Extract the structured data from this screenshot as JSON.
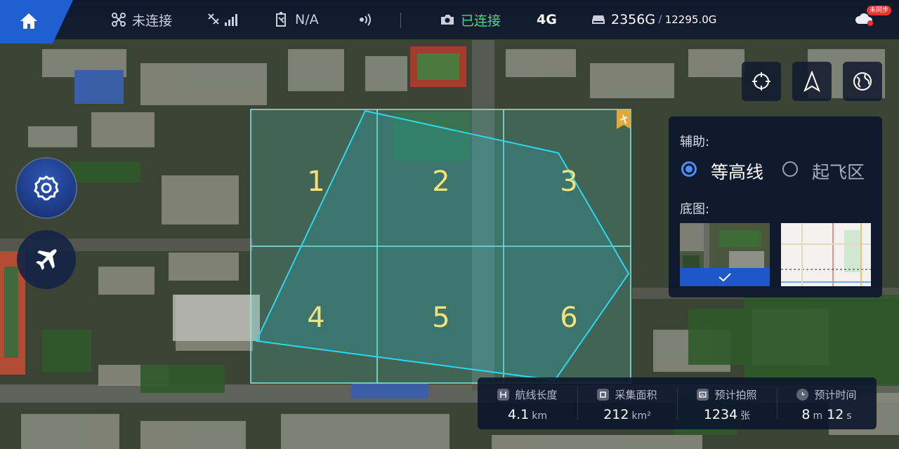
{
  "topbar": {
    "drone_status": "未连接",
    "signal_icon": "satellite-signal-icon",
    "battery_value": "N/A",
    "camera_status": "已连接",
    "network": "4G",
    "storage_used": "2356G",
    "storage_sep": " / ",
    "storage_total": "12295.0G",
    "sync_badge": "未同步"
  },
  "panel": {
    "assist_label": "辅助:",
    "contour_label": "等高线",
    "takeoff_label": "起飞区",
    "basemap_label": "底图:"
  },
  "grid_cells": [
    "1",
    "2",
    "3",
    "4",
    "5",
    "6"
  ],
  "stats": [
    {
      "label": "航线长度",
      "value": "4.1",
      "unit": "km"
    },
    {
      "label": "采集面积",
      "value": "212",
      "unit": "km²"
    },
    {
      "label": "预计拍照",
      "value": "1234",
      "unit": "张"
    },
    {
      "label": "预计时间",
      "value": "8",
      "unit": "m",
      "value2": "12",
      "unit2": "s"
    }
  ],
  "colors": {
    "accent": "#1f5fd0",
    "connected": "#3ee07a",
    "grid": "#7ee8e0",
    "polygon": "#2fd6f0",
    "cell_number": "#f2e27a"
  }
}
